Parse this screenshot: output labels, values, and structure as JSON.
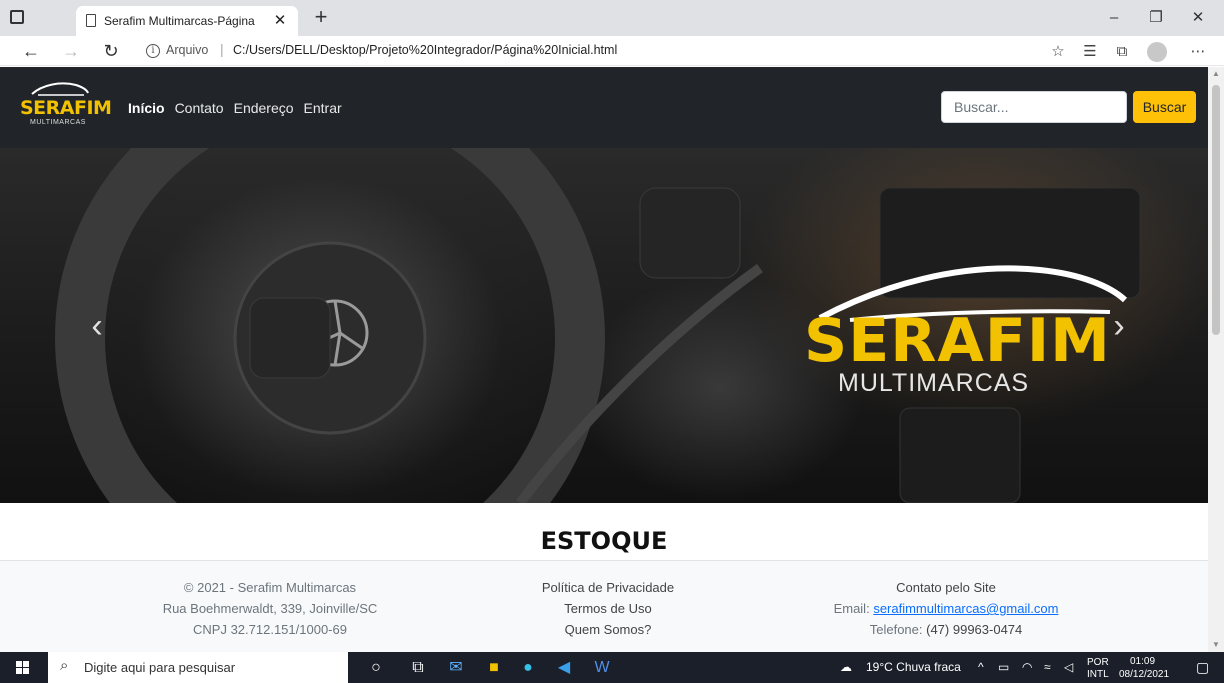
{
  "browser": {
    "tab_title": "Serafim Multimarcas-Página Inicial",
    "address_label": "Arquivo",
    "url": "C:/Users/DELL/Desktop/Projeto%20Integrador/Página%20Inicial.html"
  },
  "navbar": {
    "brand_name": "SERAFIM",
    "brand_sub": "MULTIMARCAS",
    "links": [
      {
        "label": "Início",
        "active": true
      },
      {
        "label": "Contato"
      },
      {
        "label": "Endereço"
      },
      {
        "label": "Entrar"
      }
    ],
    "search_placeholder": "Buscar...",
    "search_button": "Buscar"
  },
  "carousel": {
    "logo_name": "SERAFIM",
    "logo_sub": "MULTIMARCAS",
    "prev": "‹",
    "next": "›"
  },
  "main": {
    "section_title": "ESTOQUE"
  },
  "footer": {
    "col1": [
      "© 2021 - Serafim Multimarcas",
      "Rua Boehmerwaldt, 339, Joinville/SC",
      "CNPJ 32.712.151/1000-69"
    ],
    "col2": [
      "Política de Privacidade",
      "Termos de Uso",
      "Quem Somos?"
    ],
    "col3_title": "Contato pelo Site",
    "email_label": "Email:",
    "email": "serafimmultimarcas@gmail.com",
    "phone_label": "Telefone:",
    "phone": "(47) 99963-0474"
  },
  "taskbar": {
    "search_placeholder": "Digite aqui para pesquisar",
    "weather": "19°C  Chuva fraca",
    "lang_top": "POR",
    "lang_bottom": "INTL",
    "time": "01:09",
    "date": "08/12/2021"
  },
  "colors": {
    "navbar": "#212529",
    "accent_yellow": "#ffc107",
    "brand_yellow": "#f2c200",
    "link_blue": "#0d6efd",
    "taskbar": "#1a1f29"
  }
}
